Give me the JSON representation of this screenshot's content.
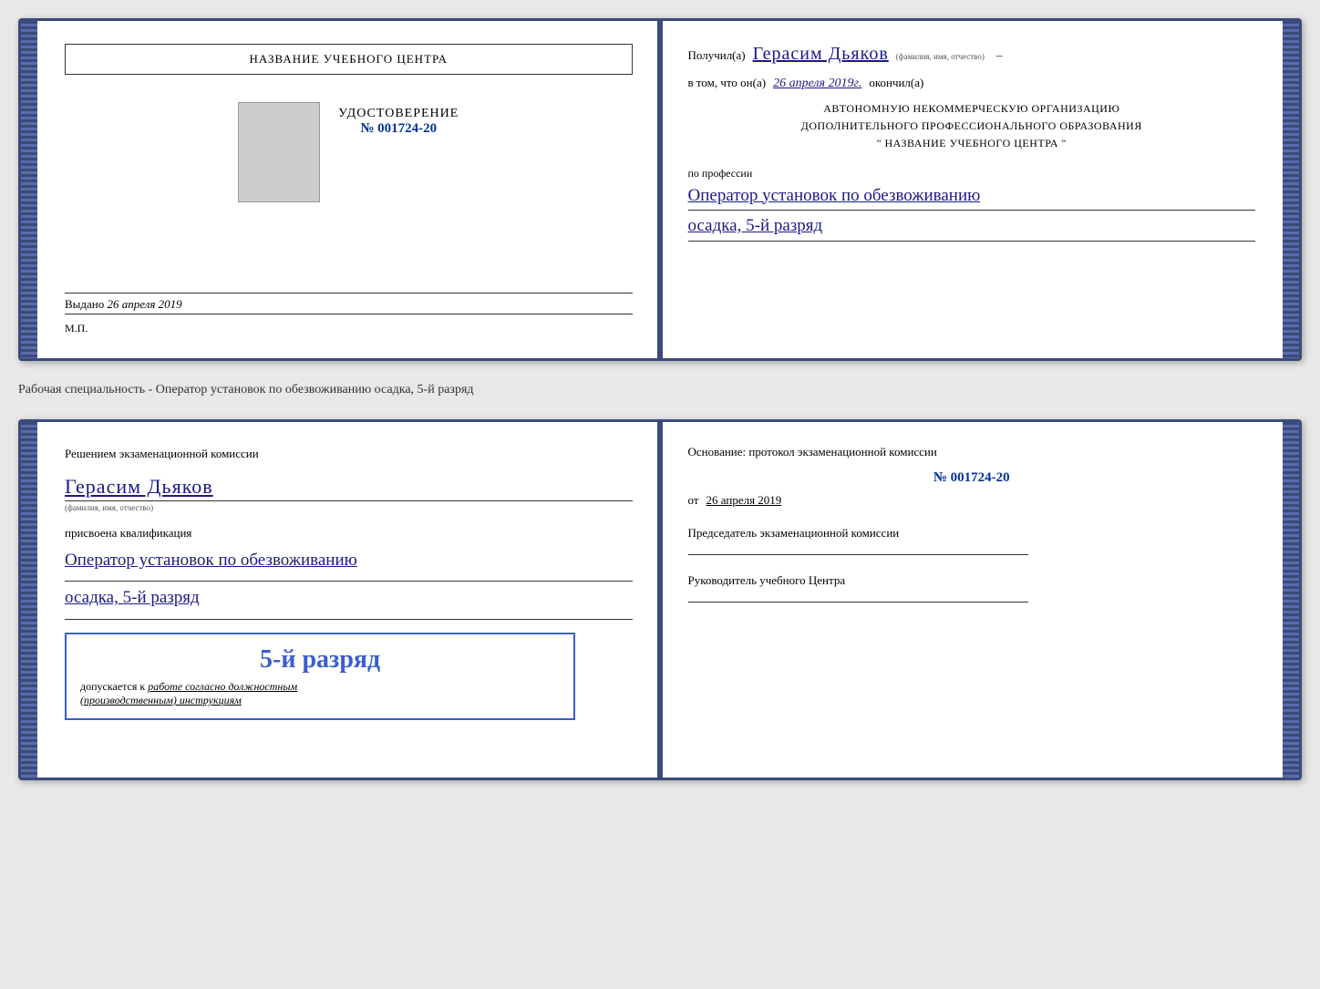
{
  "doc1": {
    "left": {
      "title_box": "НАЗВАНИЕ УЧЕБНОГО ЦЕНТРА",
      "udost_label": "УДОСТОВЕРЕНИЕ",
      "number": "№ 001724-20",
      "vydano_label": "Выдано",
      "vydano_date": "26 апреля 2019",
      "mp": "М.П."
    },
    "right": {
      "poluchil_label": "Получил(а)",
      "recipient_name": "Герасим Дьяков",
      "fio_subtitle": "(фамилия, имя, отчество)",
      "dash": "–",
      "vtom_label": "в том, что он(а)",
      "vtom_date": "26 апреля 2019г.",
      "okonchil_label": "окончил(а)",
      "org_line1": "АВТОНОМНУЮ НЕКОММЕРЧЕСКУЮ ОРГАНИЗАЦИЮ",
      "org_line2": "ДОПОЛНИТЕЛЬНОГО ПРОФЕССИОНАЛЬНОГО ОБРАЗОВАНИЯ",
      "org_line3": "\" НАЗВАНИЕ УЧЕБНОГО ЦЕНТРА \"",
      "po_professii": "по профессии",
      "profession_line1": "Оператор установок по обезвоживанию",
      "profession_line2": "осадка, 5-й разряд"
    }
  },
  "desc_line": "Рабочая специальность - Оператор установок по обезвоживанию осадка, 5-й разряд",
  "doc2": {
    "left": {
      "title_line1": "Решением экзаменационной комиссии",
      "recipient_name": "Герасим Дьяков",
      "fio_subtitle": "(фамилия, имя, отчество)",
      "prisvoena": "присвоена квалификация",
      "qualification_line1": "Оператор установок по обезвоживанию",
      "qualification_line2": "осадка, 5-й разряд",
      "stamp_rank": "5-й разряд",
      "stamp_text1": "допускается к",
      "stamp_underline": "работе согласно должностным",
      "stamp_text2": "(производственным) инструкциям"
    },
    "right": {
      "osnov_label": "Основание: протокол экзаменационной комиссии",
      "protocol_num": "№ 001724-20",
      "ot_prefix": "от",
      "ot_date": "26 апреля 2019",
      "chairman_title": "Председатель экзаменационной комиссии",
      "ruk_title": "Руководитель учебного Центра"
    }
  }
}
